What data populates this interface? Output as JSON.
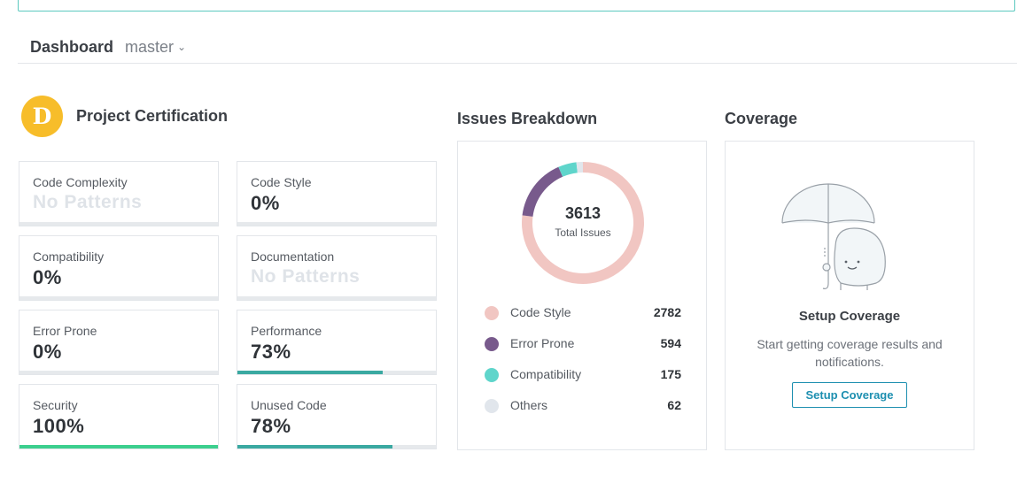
{
  "subnav": {
    "title": "Dashboard",
    "branch": "master"
  },
  "certification": {
    "grade": "D",
    "title": "Project Certification",
    "cards": [
      {
        "label": "Code Complexity",
        "value": "No Patterns",
        "muted": true,
        "progress": null
      },
      {
        "label": "Code Style",
        "value": "0%",
        "muted": false,
        "progress": 0
      },
      {
        "label": "Compatibility",
        "value": "0%",
        "muted": false,
        "progress": 0
      },
      {
        "label": "Documentation",
        "value": "No Patterns",
        "muted": true,
        "progress": null
      },
      {
        "label": "Error Prone",
        "value": "0%",
        "muted": false,
        "progress": 0
      },
      {
        "label": "Performance",
        "value": "73%",
        "muted": false,
        "progress": 73,
        "color": "#3aa9a1"
      },
      {
        "label": "Security",
        "value": "100%",
        "muted": false,
        "progress": 100,
        "color": "#3ccf8e"
      },
      {
        "label": "Unused Code",
        "value": "78%",
        "muted": false,
        "progress": 78,
        "color": "#3aa9a1"
      }
    ]
  },
  "issues": {
    "title": "Issues Breakdown",
    "total": "3613",
    "total_label": "Total Issues",
    "items": [
      {
        "name": "Code Style",
        "count": "2782",
        "color": "#f1c6c2"
      },
      {
        "name": "Error Prone",
        "count": "594",
        "color": "#785a8c"
      },
      {
        "name": "Compatibility",
        "count": "175",
        "color": "#5fd5cb"
      },
      {
        "name": "Others",
        "count": "62",
        "color": "#e1e6ec"
      }
    ]
  },
  "chart_data": {
    "type": "pie",
    "categories": [
      "Code Style",
      "Error Prone",
      "Compatibility",
      "Others"
    ],
    "values": [
      2782,
      594,
      175,
      62
    ],
    "title": "Issues Breakdown"
  },
  "coverage": {
    "title": "Coverage",
    "setup_title": "Setup Coverage",
    "description": "Start getting coverage results and notifications.",
    "button_label": "Setup Coverage"
  }
}
